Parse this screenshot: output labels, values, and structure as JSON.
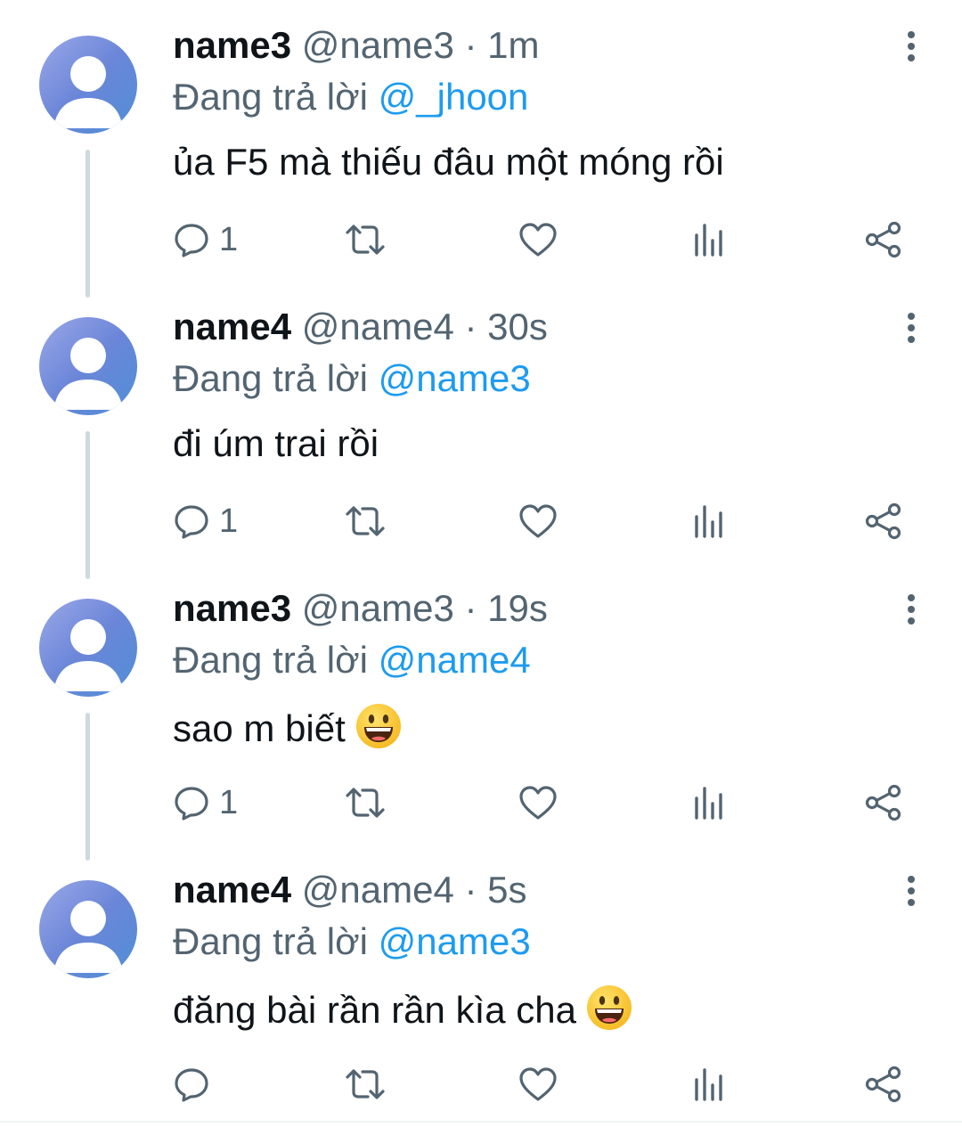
{
  "colors": {
    "mention": "#1d9bf0",
    "secondary_text": "#536471",
    "thread_line": "#cfd9de"
  },
  "icons": {
    "reply": "reply-icon",
    "retweet": "retweet-icon",
    "like": "heart-icon",
    "views": "views-icon",
    "share": "share-icon",
    "more": "more-vertical-icon",
    "avatar": "default-avatar-icon",
    "emoji": "grinning-face-emoji"
  },
  "tweets": [
    {
      "name": "name3",
      "handle": "@name3",
      "separator": "·",
      "time": "1m",
      "reply_prefix": "Đang trả lời",
      "reply_to": "@_jhoon",
      "text": "ủa F5 mà thiếu đâu một móng rồi",
      "has_emoji": false,
      "reply_count": "1"
    },
    {
      "name": "name4",
      "handle": "@name4",
      "separator": "·",
      "time": "30s",
      "reply_prefix": "Đang trả lời",
      "reply_to": "@name3",
      "text": "đi úm trai rồi",
      "has_emoji": false,
      "reply_count": "1"
    },
    {
      "name": "name3",
      "handle": "@name3",
      "separator": "·",
      "time": "19s",
      "reply_prefix": "Đang trả lời",
      "reply_to": "@name4",
      "text": "sao m biết",
      "has_emoji": true,
      "reply_count": "1"
    },
    {
      "name": "name4",
      "handle": "@name4",
      "separator": "·",
      "time": "5s",
      "reply_prefix": "Đang trả lời",
      "reply_to": "@name3",
      "text": "đăng bài rần rần kìa cha",
      "has_emoji": true,
      "reply_count": ""
    }
  ]
}
